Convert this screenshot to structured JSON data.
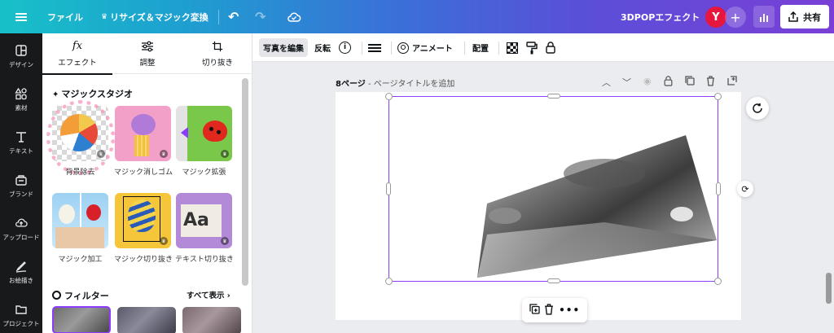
{
  "topbar": {
    "file_label": "ファイル",
    "resize_label": "リサイズ＆マジック変換",
    "design_title": "3DPOPエフェクト",
    "avatar_initial": "Y",
    "share_label": "共有"
  },
  "rail": [
    {
      "label": "デザイン",
      "icon": "layout-icon"
    },
    {
      "label": "素材",
      "icon": "shapes-icon"
    },
    {
      "label": "テキスト",
      "icon": "text-icon"
    },
    {
      "label": "ブランド",
      "icon": "brand-icon"
    },
    {
      "label": "アップロード",
      "icon": "upload-icon"
    },
    {
      "label": "お絵描き",
      "icon": "draw-icon"
    },
    {
      "label": "プロジェクト",
      "icon": "folder-icon"
    }
  ],
  "panel": {
    "tabs": [
      {
        "label": "エフェクト",
        "icon": "fx"
      },
      {
        "label": "調整",
        "icon": "sliders-icon"
      },
      {
        "label": "切り抜き",
        "icon": "crop-icon"
      }
    ],
    "magic_title": "マジックスタジオ",
    "magic_items": [
      {
        "label": "背景除去"
      },
      {
        "label": "マジック消しゴム"
      },
      {
        "label": "マジック拡張"
      },
      {
        "label": "マジック加工"
      },
      {
        "label": "マジック切り抜き"
      },
      {
        "label": "テキスト切り抜き"
      }
    ],
    "filter_title": "フィルター",
    "see_all": "すべて表示"
  },
  "context_toolbar": {
    "edit_photo": "写真を編集",
    "flip": "反転",
    "animate": "アニメート",
    "position": "配置"
  },
  "canvas": {
    "page_number": "8ページ",
    "page_title_placeholder": "ページタイトルを追加"
  },
  "colors": {
    "accent": "#8b3dff",
    "topbar_start": "#17c1c8",
    "topbar_end": "#7a3fd6",
    "rail_bg": "#18191b",
    "avatar": "#e5173f"
  }
}
